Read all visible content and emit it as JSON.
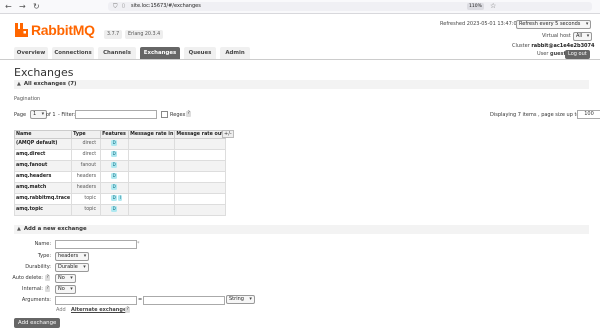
{
  "browser": {
    "back": "←",
    "forward": "→",
    "reload": "↻",
    "url": "site.loc:15673/#/exchanges",
    "zoom": "110%",
    "star": "☆"
  },
  "header": {
    "logo_text": "RabbitMQ",
    "version": "3.7.7",
    "erlang": "Erlang 20.3.4",
    "refreshed": "Refreshed 2023-05-01 13:47:09",
    "refresh_select": "Refresh every 5 seconds",
    "vhost_label": "Virtual host",
    "vhost_select": "All",
    "cluster_label": "Cluster",
    "cluster_value": "rabbit@ac1e4e2b3074",
    "user_label": "User",
    "user_value": "guest",
    "logout": "Log out"
  },
  "tabs": [
    "Overview",
    "Connections",
    "Channels",
    "Exchanges",
    "Queues",
    "Admin"
  ],
  "active_tab": "Exchanges",
  "page": {
    "title": "Exchanges",
    "section": "All exchanges (7)",
    "pagination_head": "Pagination",
    "page_label": "Page",
    "page_value": "1",
    "of_label": "of 1",
    "filter_label": "- Filter:",
    "regex_label": "Regex",
    "q": "?",
    "displaying": "Displaying 7 items , page size up to:",
    "page_size": "100"
  },
  "table": {
    "headers": [
      "Name",
      "Type",
      "Features",
      "Message rate in",
      "Message rate out",
      "+/-"
    ],
    "rows": [
      {
        "name": "(AMQP default)",
        "type": "direct",
        "features": [
          "D"
        ]
      },
      {
        "name": "amq.direct",
        "type": "direct",
        "features": [
          "D"
        ]
      },
      {
        "name": "amq.fanout",
        "type": "fanout",
        "features": [
          "D"
        ]
      },
      {
        "name": "amq.headers",
        "type": "headers",
        "features": [
          "D"
        ]
      },
      {
        "name": "amq.match",
        "type": "headers",
        "features": [
          "D"
        ]
      },
      {
        "name": "amq.rabbitmq.trace",
        "type": "topic",
        "features": [
          "D",
          "I"
        ]
      },
      {
        "name": "amq.topic",
        "type": "topic",
        "features": [
          "D"
        ]
      }
    ]
  },
  "add": {
    "section": "Add a new exchange",
    "name_label": "Name:",
    "required": "*",
    "type_label": "Type:",
    "type_value": "headers",
    "durability_label": "Durability:",
    "durability_value": "Durable",
    "autodelete_label": "Auto delete:",
    "autodelete_value": "No",
    "internal_label": "Internal:",
    "internal_value": "No",
    "arguments_label": "Arguments:",
    "equals": "=",
    "arg_type": "String",
    "add_link": "Add",
    "alternate": "Alternate exchange",
    "button": "Add exchange"
  }
}
